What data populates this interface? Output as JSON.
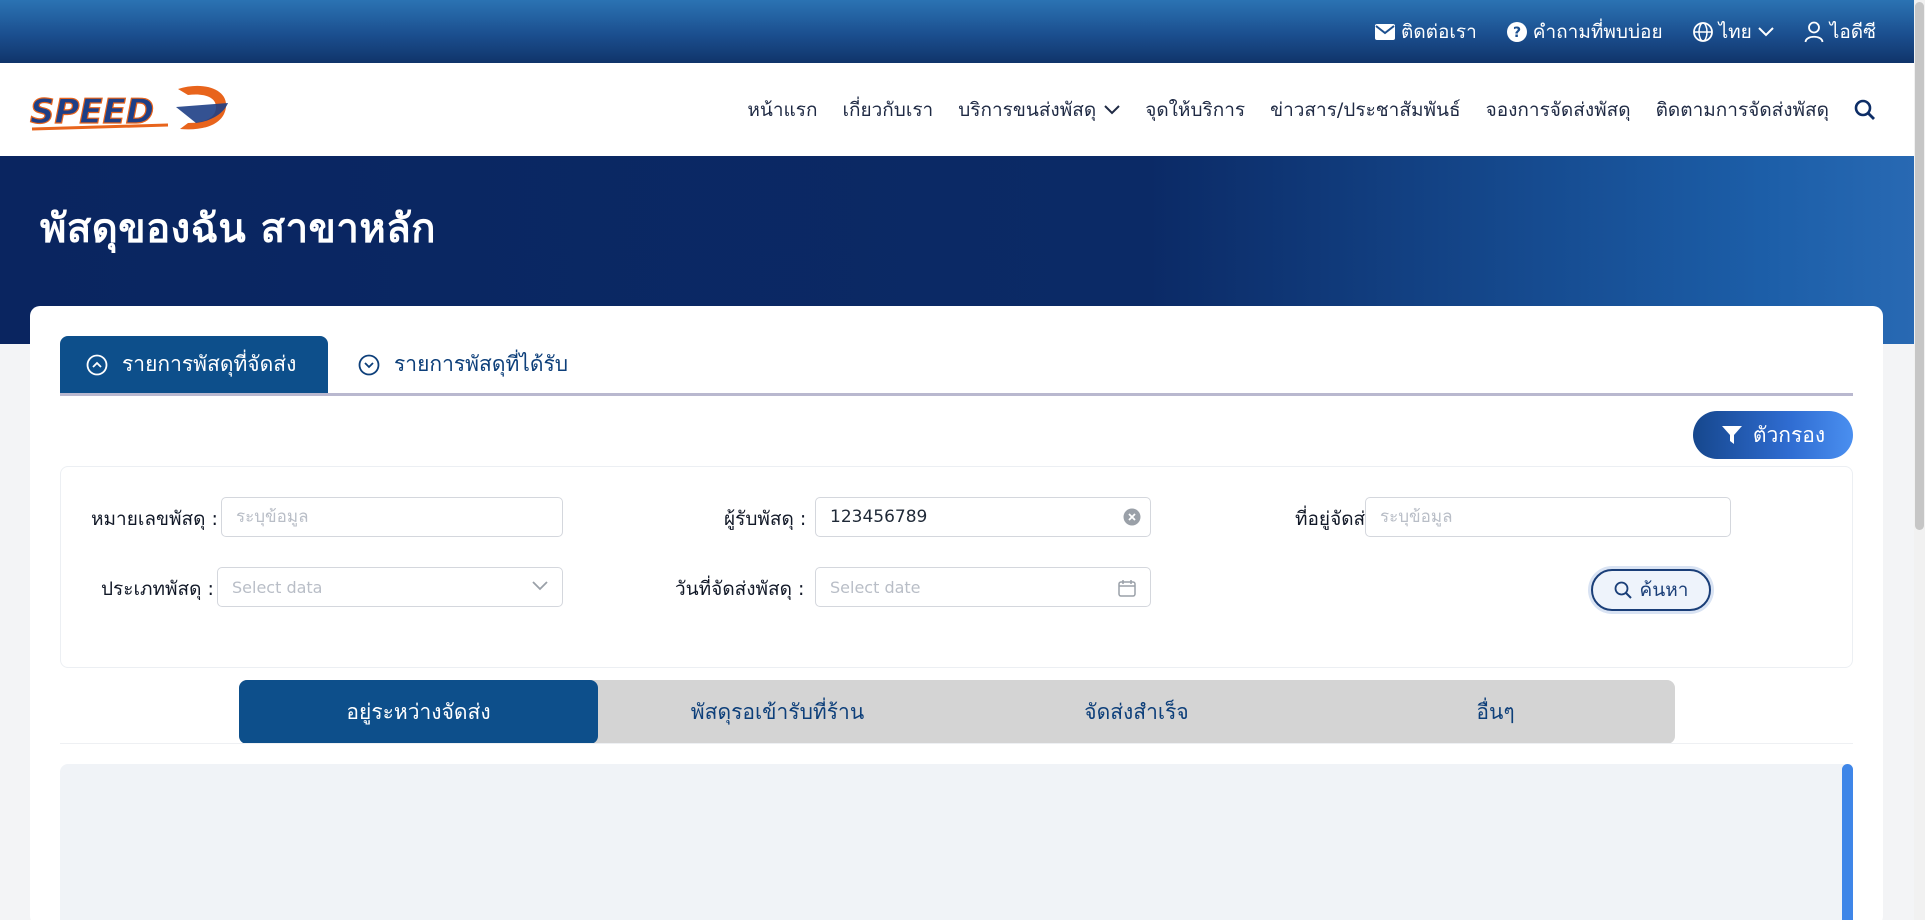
{
  "topbar": {
    "contact_label": "ติดต่อเรา",
    "faq_label": "คำถามที่พบบ่อย",
    "language_label": "ไทย",
    "user_label": "ไอดีซี"
  },
  "nav": {
    "logo_text": "SPEED-D",
    "items": [
      "หน้าแรก",
      "เกี่ยวกับเรา",
      "บริการขนส่งพัสดุ",
      "จุดให้บริการ",
      "ข่าวสาร/ประชาสัมพันธ์",
      "จองการจัดส่งพัสดุ",
      "ติดตามการจัดส่งพัสดุ"
    ]
  },
  "hero": {
    "title": "พัสดุของฉัน สาขาหลัก"
  },
  "tabs": {
    "sent_label": "รายการพัสดุที่จัดส่ง",
    "received_label": "รายการพัสดุที่ได้รับ"
  },
  "filter": {
    "button_label": "ตัวกรอง",
    "parcel_no_label": "หมายเลขพัสดุ :",
    "parcel_no_placeholder": "ระบุข้อมูล",
    "receiver_label": "ผู้รับพัสดุ :",
    "receiver_value": "123456789",
    "address_label": "ที่อยู่จัดส่ง :",
    "address_placeholder": "ระบุข้อมูล",
    "type_label": "ประเภทพัสดุ :",
    "type_placeholder": "Select data",
    "date_label": "วันที่จัดส่งพัสดุ :",
    "date_placeholder": "Select date",
    "search_label": "ค้นหา"
  },
  "status_tabs": [
    "อยู่ระหว่างจัดส่ง",
    "พัสดุรอเข้ารับที่ร้าน",
    "จัดส่งสำเร็จ",
    "อื่นๆ"
  ],
  "colors": {
    "primary": "#0d4f8b",
    "hero_dark": "#0a2560",
    "accent_orange": "#e8641c"
  }
}
